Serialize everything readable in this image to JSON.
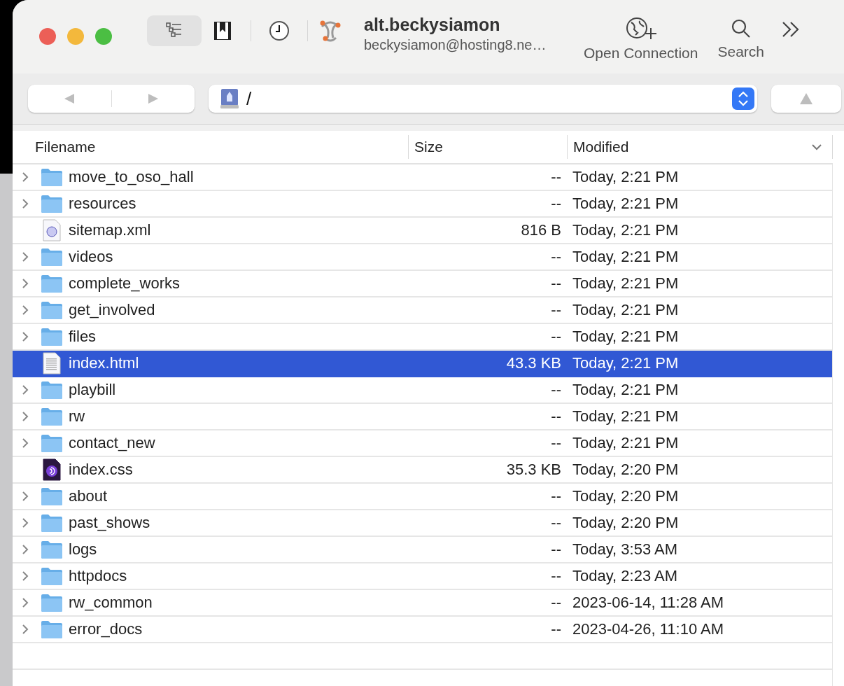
{
  "toolbar": {
    "view_buttons": [
      {
        "kind": "outline",
        "selected": true
      },
      {
        "kind": "bookmarks",
        "selected": false
      },
      {
        "kind": "history",
        "selected": false
      }
    ],
    "connection": {
      "title": "alt.beckysiamon",
      "subtitle": "beckysiamon@hosting8.ne…"
    },
    "actions": [
      {
        "kind": "open_connection",
        "label": "Open Connection"
      },
      {
        "kind": "search",
        "label": "Search"
      }
    ]
  },
  "path_bar": {
    "path": "/"
  },
  "table": {
    "columns": [
      "Filename",
      "Size",
      "Modified"
    ],
    "rows": [
      {
        "kind": "folder",
        "name": "move_to_oso_hall",
        "size": "--",
        "modified": "Today, 2:21 PM",
        "selected": false
      },
      {
        "kind": "folder",
        "name": "resources",
        "size": "--",
        "modified": "Today, 2:21 PM",
        "selected": false
      },
      {
        "kind": "xml",
        "name": "sitemap.xml",
        "size": "816 B",
        "modified": "Today, 2:21 PM",
        "selected": false
      },
      {
        "kind": "folder",
        "name": "videos",
        "size": "--",
        "modified": "Today, 2:21 PM",
        "selected": false
      },
      {
        "kind": "folder",
        "name": "complete_works",
        "size": "--",
        "modified": "Today, 2:21 PM",
        "selected": false
      },
      {
        "kind": "folder",
        "name": "get_involved",
        "size": "--",
        "modified": "Today, 2:21 PM",
        "selected": false
      },
      {
        "kind": "folder",
        "name": "files",
        "size": "--",
        "modified": "Today, 2:21 PM",
        "selected": false
      },
      {
        "kind": "html",
        "name": "index.html",
        "size": "43.3 KB",
        "modified": "Today, 2:21 PM",
        "selected": true
      },
      {
        "kind": "folder",
        "name": "playbill",
        "size": "--",
        "modified": "Today, 2:21 PM",
        "selected": false
      },
      {
        "kind": "folder",
        "name": "rw",
        "size": "--",
        "modified": "Today, 2:21 PM",
        "selected": false
      },
      {
        "kind": "folder",
        "name": "contact_new",
        "size": "--",
        "modified": "Today, 2:21 PM",
        "selected": false
      },
      {
        "kind": "css",
        "name": "index.css",
        "size": "35.3 KB",
        "modified": "Today, 2:20 PM",
        "selected": false
      },
      {
        "kind": "folder",
        "name": "about",
        "size": "--",
        "modified": "Today, 2:20 PM",
        "selected": false
      },
      {
        "kind": "folder",
        "name": "past_shows",
        "size": "--",
        "modified": "Today, 2:20 PM",
        "selected": false
      },
      {
        "kind": "folder",
        "name": "logs",
        "size": "--",
        "modified": "Today, 3:53 AM",
        "selected": false
      },
      {
        "kind": "folder",
        "name": "httpdocs",
        "size": "--",
        "modified": "Today, 2:23 AM",
        "selected": false
      },
      {
        "kind": "folder",
        "name": "rw_common",
        "size": "--",
        "modified": "2023-06-14, 11:28 AM",
        "selected": false
      },
      {
        "kind": "folder",
        "name": "error_docs",
        "size": "--",
        "modified": "2023-04-26, 11:10 AM",
        "selected": false
      }
    ]
  }
}
